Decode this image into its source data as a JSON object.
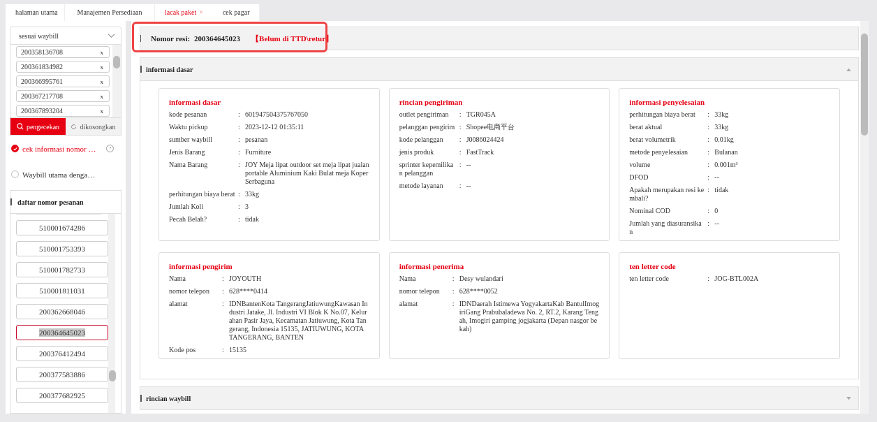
{
  "tabs": [
    {
      "label": "halaman utama",
      "selected": false
    },
    {
      "label": "Manajemen Persediaan",
      "selected": false
    },
    {
      "label": "lacak paket",
      "selected": true,
      "close": "×"
    },
    {
      "label": "cek pagar",
      "selected": false
    }
  ],
  "sidebar": {
    "query_type": "sesuai waybill",
    "waybill_tags": [
      {
        "number": "200358136708",
        "remove": "x"
      },
      {
        "number": "200361834982",
        "remove": "x"
      },
      {
        "number": "200366995761",
        "remove": "x"
      },
      {
        "number": "200367217708",
        "remove": "x"
      },
      {
        "number": "200367893204",
        "remove": "x"
      }
    ],
    "buttons": [
      {
        "label": "pengecekan",
        "kind": "primary"
      },
      {
        "label": "dikosongkan",
        "kind": "secondary"
      }
    ],
    "options": [
      {
        "label": "cek informasi nomor …",
        "checked": true,
        "help": "?"
      },
      {
        "label": "Waybill utama denga…",
        "checked": false
      }
    ],
    "order_list": {
      "title": "daftar nomor pesanan",
      "items": [
        {
          "label": "510001674286",
          "selected": false
        },
        {
          "label": "510001753393",
          "selected": false
        },
        {
          "label": "510001782733",
          "selected": false
        },
        {
          "label": "510001811031",
          "selected": false
        },
        {
          "label": "200362668046",
          "selected": false
        },
        {
          "label": "200364645023",
          "selected": true
        },
        {
          "label": "200376412494",
          "selected": false
        },
        {
          "label": "200377583886",
          "selected": false
        },
        {
          "label": "200377682925",
          "selected": false
        }
      ]
    }
  },
  "receipt": {
    "label": "Nomor resi:",
    "number": "200364645023",
    "status": "【Belum di TTD\\retur】",
    "highlighted": true
  },
  "separator": ":",
  "sections": [
    {
      "title": "informasi dasar",
      "expanded": true,
      "cards": [
        {
          "title": "informasi dasar",
          "fields": [
            {
              "label": "kode pesanan",
              "value": "601947504375767050"
            },
            {
              "label": "Waktu pickup",
              "value": "2023-12-12 01:35:11"
            },
            {
              "label": "sumber waybill",
              "value": "pesanan"
            },
            {
              "label": "Jenis Barang",
              "value": "Furniture"
            },
            {
              "label": "Nama Barang",
              "value": "JOY Meja lipat outdoor set meja lipat jualan portable Aluminium Kaki Bulat meja Koper Serbaguna"
            },
            {
              "label": "perhitungan biaya berat",
              "value": "33kg"
            },
            {
              "label": "Jumlah Koli",
              "value": "3"
            },
            {
              "label": "Pecah Belah?",
              "value": "tidak"
            }
          ]
        },
        {
          "title": "rincian pengiriman",
          "fields": [
            {
              "label": "outlet pengiriman",
              "value": "TGR045A"
            },
            {
              "label": "pelanggan pengirim",
              "value": "Shopee电商平台"
            },
            {
              "label": "kode pelanggan",
              "value": "J0086024424"
            },
            {
              "label": "jenis produk",
              "value": "FastTrack"
            },
            {
              "label": "sprinter kepemilikan pelanggan",
              "value": "--"
            },
            {
              "label": "metode layanan",
              "value": "--"
            }
          ]
        },
        {
          "title": "informasi penyelesaian",
          "fields": [
            {
              "label": "perhitungan biaya berat",
              "value": "33kg"
            },
            {
              "label": "berat aktual",
              "value": "33kg"
            },
            {
              "label": "berat volumetrik",
              "value": "0.01kg"
            },
            {
              "label": "metode penyelesaian",
              "value": "Bulanan"
            },
            {
              "label": "volume",
              "value": "0.001m³"
            },
            {
              "label": "DFOD",
              "value": "--"
            },
            {
              "label": "Apakah merupakan resi kembali?",
              "value": "tidak"
            },
            {
              "label": "Nominal COD",
              "value": "0"
            },
            {
              "label": "Jumlah yang diasuransikan",
              "value": "--"
            }
          ]
        },
        {
          "title": "informasi pengirim",
          "fields": [
            {
              "label": "Nama",
              "value": "JOYOUTH"
            },
            {
              "label": "nomor telepon",
              "value": "628****0414"
            },
            {
              "label": "alamat",
              "value": "IDNBantenKota TangerangJatiuwungKawasan Industri Jatake, Jl. Industri VI Blok K No.07, Kelurahan Pasir Jaya, Kecamatan Jatiuwung, Kota Tangerang, Indonesia 15135, JATIUWUNG, KOTA TANGERANG, BANTEN"
            },
            {
              "label": "Kode pos",
              "value": "15135"
            }
          ]
        },
        {
          "title": "informasi penerima",
          "fields": [
            {
              "label": "Nama",
              "value": "Desy wulandari"
            },
            {
              "label": "nomor telepon",
              "value": "628****0052"
            },
            {
              "label": "alamat",
              "value": "IDNDaerah Istimewa YogyakartaKab BantulImogiriGang Prabubaladewa No. 2, RT.2, Karang Tengah, Imogiri gamping jogjakarta (Depan nasgor bekah)"
            }
          ]
        },
        {
          "title": "ten letter code",
          "fields": [
            {
              "label": "ten letter code",
              "value": "JOG-BTL002A"
            }
          ]
        }
      ]
    },
    {
      "title": "rincian waybill",
      "expanded": false
    }
  ]
}
